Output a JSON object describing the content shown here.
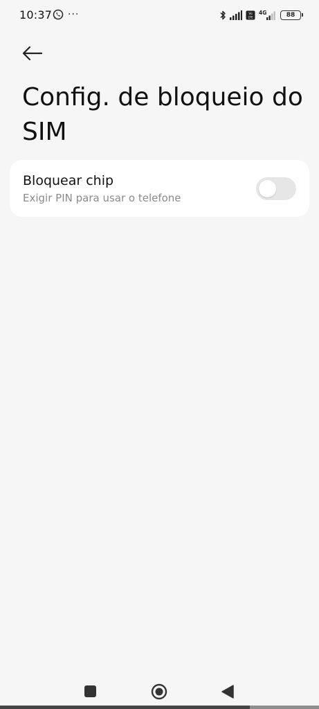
{
  "status_bar": {
    "time": "10:37",
    "more": "···",
    "battery": "88",
    "network_label": "4G",
    "volte_label": "Vo LTE"
  },
  "header": {
    "title": "Config. de bloqueio do SIM"
  },
  "settings": {
    "lock_chip": {
      "title": "Bloquear chip",
      "subtitle": "Exigir PIN para usar o telefone",
      "enabled": false
    }
  },
  "colors": {
    "background": "#f6f6f6",
    "card": "#ffffff",
    "toggle_off": "#e6e6e6",
    "subtitle": "#8a8a8a"
  }
}
